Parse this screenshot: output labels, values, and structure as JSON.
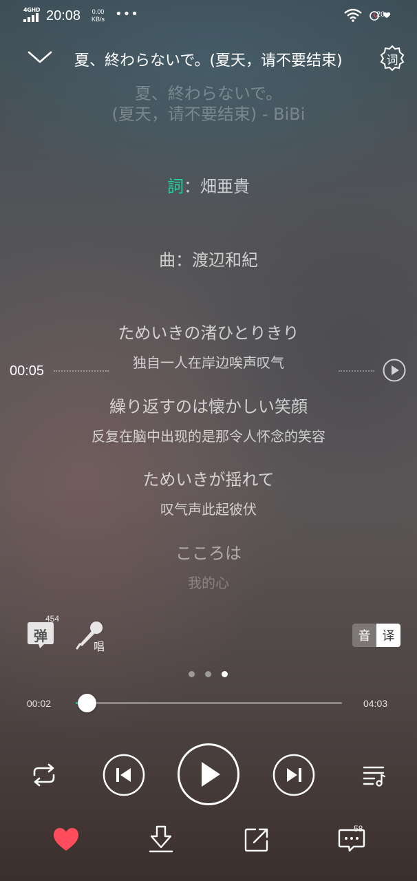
{
  "status_bar": {
    "network": "4GHD",
    "time": "20:08",
    "speed_value": "0.00",
    "speed_unit": "KB/s",
    "more": "•••",
    "alarm_badge": "20"
  },
  "header": {
    "title": "夏、終わらないで。(夏天，请不要结束) - BiBi",
    "lyric_mode_label": "词"
  },
  "lyrics": {
    "faded_top_1": "夏、終わらないで。",
    "faded_top_2": "(夏天，请不要结束) - BiBi",
    "lyricist_first_char": "詞",
    "lyricist_rest": "：畑亜貴",
    "composer": "曲：渡辺和紀",
    "lines": [
      {
        "ja": "ためいきの渚ひとりきり",
        "zh": "独自一人在岸边唉声叹气"
      },
      {
        "ja": "繰り返すのは懐かしい笑顔",
        "zh": "反复在脑中出现的是那令人怀念的笑容"
      },
      {
        "ja": "ためいきが揺れて",
        "zh": "叹气声此起彼伏"
      },
      {
        "ja": "こころは",
        "zh": "我的心"
      }
    ],
    "scrub_time": "00:05"
  },
  "tools": {
    "danmu_label": "弹",
    "danmu_count": "454",
    "sing_label": "唱",
    "phonetic_label": "音",
    "translate_label": "译",
    "page_count": 3,
    "page_active": 3
  },
  "progress": {
    "current": "00:02",
    "total": "04:03",
    "fraction": 0.041
  },
  "actions": {
    "comment_count": "58"
  },
  "colors": {
    "accent": "#1ed29a",
    "heart": "#ff4d5e"
  }
}
